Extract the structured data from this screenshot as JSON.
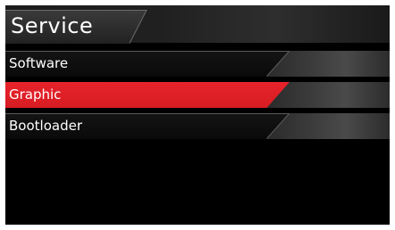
{
  "header": {
    "title": "Service"
  },
  "menu": {
    "items": [
      {
        "label": "Software",
        "selected": false
      },
      {
        "label": "Graphic",
        "selected": true
      },
      {
        "label": "Bootloader",
        "selected": false
      }
    ]
  },
  "colors": {
    "accent": "#e8232a",
    "background": "#000000",
    "text": "#ffffff"
  }
}
